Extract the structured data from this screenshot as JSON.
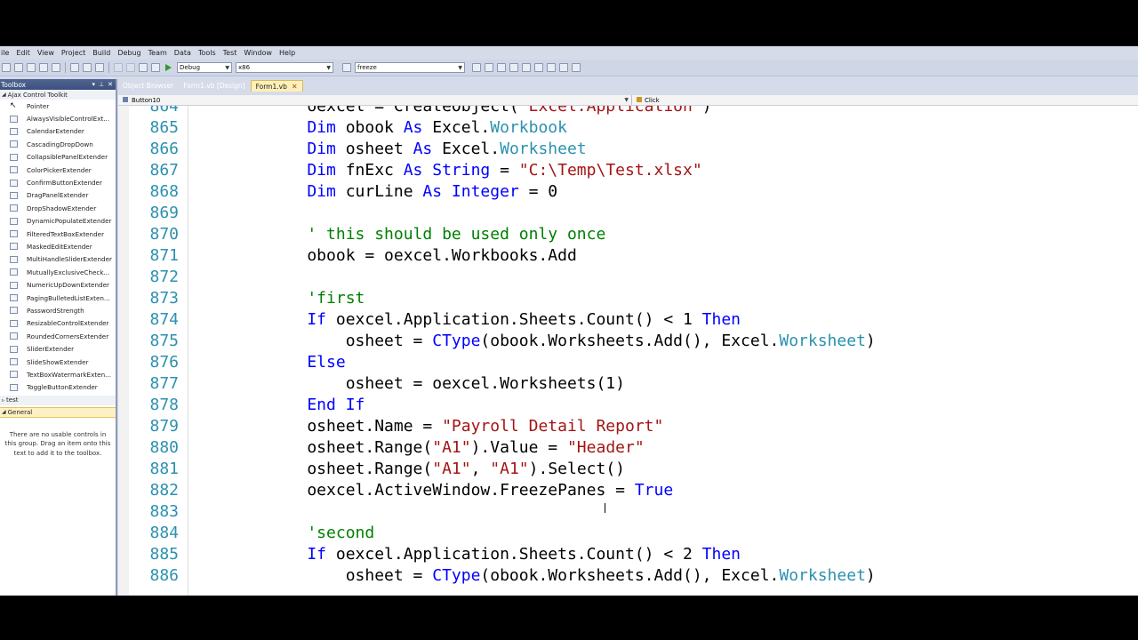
{
  "menu": [
    "ile",
    "Edit",
    "View",
    "Project",
    "Build",
    "Debug",
    "Team",
    "Data",
    "Tools",
    "Test",
    "Window",
    "Help"
  ],
  "toolbar": {
    "config": "Debug",
    "platform": "x86",
    "find": "freeze"
  },
  "toolbox": {
    "title": "Toolbox",
    "group_ajax": "Ajax Control Toolkit",
    "items": [
      "Pointer",
      "AlwaysVisibleControlExt...",
      "CalendarExtender",
      "CascadingDropDown",
      "CollapsiblePanelExtender",
      "ColorPickerExtender",
      "ConfirmButtonExtender",
      "DragPanelExtender",
      "DropShadowExtender",
      "DynamicPopulateExtender",
      "FilteredTextBoxExtender",
      "MaskedEditExtender",
      "MultiHandleSliderExtender",
      "MutuallyExclusiveCheck...",
      "NumericUpDownExtender",
      "PagingBulletedListExten...",
      "PasswordStrength",
      "ResizableControlExtender",
      "RoundedCornersExtender",
      "SliderExtender",
      "SlideShowExtender",
      "TextBoxWatermarkExten...",
      "ToggleButtonExtender"
    ],
    "group_test": "test",
    "group_general": "General",
    "empty_msg": "There are no usable controls in this group. Drag an item onto this text to add it to the toolbox."
  },
  "tabs": [
    "Object Browser",
    "Form1.vb [Design]",
    "Form1.vb"
  ],
  "nav": {
    "left": "Button10",
    "right": "Click"
  },
  "code_lines": [
    {
      "n": "864",
      "tokens": [
        [
          "p",
          "    oexcel = CreateObject("
        ],
        [
          "s",
          "\"Excel.Application\""
        ],
        [
          "p",
          ")"
        ]
      ]
    },
    {
      "n": "865",
      "tokens": [
        [
          "k",
          "    Dim"
        ],
        [
          "p",
          " obook "
        ],
        [
          "k",
          "As"
        ],
        [
          "p",
          " Excel."
        ],
        [
          "t",
          "Workbook"
        ]
      ]
    },
    {
      "n": "866",
      "tokens": [
        [
          "k",
          "    Dim"
        ],
        [
          "p",
          " osheet "
        ],
        [
          "k",
          "As"
        ],
        [
          "p",
          " Excel."
        ],
        [
          "t",
          "Worksheet"
        ]
      ]
    },
    {
      "n": "867",
      "tokens": [
        [
          "k",
          "    Dim"
        ],
        [
          "p",
          " fnExc "
        ],
        [
          "k",
          "As String"
        ],
        [
          "p",
          " = "
        ],
        [
          "s",
          "\"C:\\Temp\\Test.xlsx\""
        ]
      ]
    },
    {
      "n": "868",
      "tokens": [
        [
          "k",
          "    Dim"
        ],
        [
          "p",
          " curLine "
        ],
        [
          "k",
          "As Integer"
        ],
        [
          "p",
          " = 0"
        ]
      ]
    },
    {
      "n": "869",
      "tokens": []
    },
    {
      "n": "870",
      "tokens": [
        [
          "c",
          "    ' this should be used only once"
        ]
      ]
    },
    {
      "n": "871",
      "tokens": [
        [
          "p",
          "    obook = oexcel.Workbooks.Add"
        ]
      ]
    },
    {
      "n": "872",
      "tokens": []
    },
    {
      "n": "873",
      "tokens": [
        [
          "c",
          "    'first"
        ]
      ]
    },
    {
      "n": "874",
      "tokens": [
        [
          "k",
          "    If"
        ],
        [
          "p",
          " oexcel.Application.Sheets.Count() < 1 "
        ],
        [
          "k",
          "Then"
        ]
      ]
    },
    {
      "n": "875",
      "tokens": [
        [
          "p",
          "        osheet = "
        ],
        [
          "k",
          "CType"
        ],
        [
          "p",
          "(obook.Worksheets.Add(), Excel."
        ],
        [
          "t",
          "Worksheet"
        ],
        [
          "p",
          ")"
        ]
      ]
    },
    {
      "n": "876",
      "tokens": [
        [
          "k",
          "    Else"
        ]
      ]
    },
    {
      "n": "877",
      "tokens": [
        [
          "p",
          "        osheet = oexcel.Worksheets(1)"
        ]
      ]
    },
    {
      "n": "878",
      "tokens": [
        [
          "k",
          "    End If"
        ]
      ]
    },
    {
      "n": "879",
      "tokens": [
        [
          "p",
          "    osheet.Name = "
        ],
        [
          "s",
          "\"Payroll Detail Report\""
        ]
      ]
    },
    {
      "n": "880",
      "tokens": [
        [
          "p",
          "    osheet.Range("
        ],
        [
          "s",
          "\"A1\""
        ],
        [
          "p",
          ").Value = "
        ],
        [
          "s",
          "\"Header\""
        ]
      ]
    },
    {
      "n": "881",
      "tokens": [
        [
          "p",
          "    osheet.Range("
        ],
        [
          "s",
          "\"A1\""
        ],
        [
          "p",
          ", "
        ],
        [
          "s",
          "\"A1\""
        ],
        [
          "p",
          ").Select()"
        ]
      ]
    },
    {
      "n": "882",
      "tokens": [
        [
          "p",
          "    oexcel.ActiveWindow.FreezePanes = "
        ],
        [
          "k",
          "True"
        ]
      ]
    },
    {
      "n": "883",
      "tokens": []
    },
    {
      "n": "884",
      "tokens": [
        [
          "c",
          "    'second"
        ]
      ]
    },
    {
      "n": "885",
      "tokens": [
        [
          "k",
          "    If"
        ],
        [
          "p",
          " oexcel.Application.Sheets.Count() < 2 "
        ],
        [
          "k",
          "Then"
        ]
      ]
    },
    {
      "n": "886",
      "tokens": [
        [
          "p",
          "        osheet = "
        ],
        [
          "k",
          "CType"
        ],
        [
          "p",
          "(obook.Worksheets.Add(), Excel."
        ],
        [
          "t",
          "Worksheet"
        ],
        [
          "p",
          ")"
        ]
      ]
    }
  ]
}
